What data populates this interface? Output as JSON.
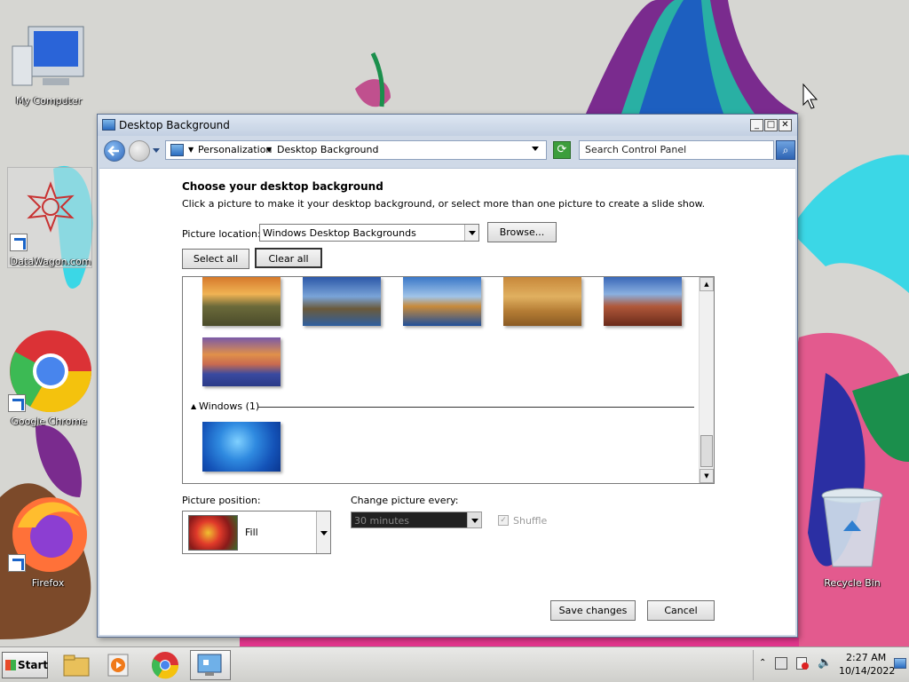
{
  "desktop": {
    "icons": [
      {
        "label": "My Computer"
      },
      {
        "label": "DataWagon.com"
      },
      {
        "label": "Google Chrome"
      },
      {
        "label": "Firefox"
      },
      {
        "label": "Recycle Bin"
      }
    ]
  },
  "window": {
    "title": "Desktop Background",
    "breadcrumb": [
      "Personalization",
      "Desktop Background"
    ],
    "search_placeholder": "Search Control Panel",
    "heading": "Choose your desktop background",
    "instructions": "Click a picture to make it your desktop background, or select more than one picture to create a slide show.",
    "picture_location_label": "Picture location:",
    "picture_location_value": "Windows Desktop Backgrounds",
    "browse_label": "Browse...",
    "select_all_label": "Select all",
    "clear_all_label": "Clear all",
    "group_windows_label": "Windows (1)",
    "picture_position_label": "Picture position:",
    "picture_position_value": "Fill",
    "change_every_label": "Change picture every:",
    "change_every_value": "30 minutes",
    "shuffle_label": "Shuffle",
    "save_label": "Save changes",
    "cancel_label": "Cancel"
  },
  "taskbar": {
    "start_label": "Start",
    "time": "2:27 AM",
    "date": "10/14/2022"
  }
}
